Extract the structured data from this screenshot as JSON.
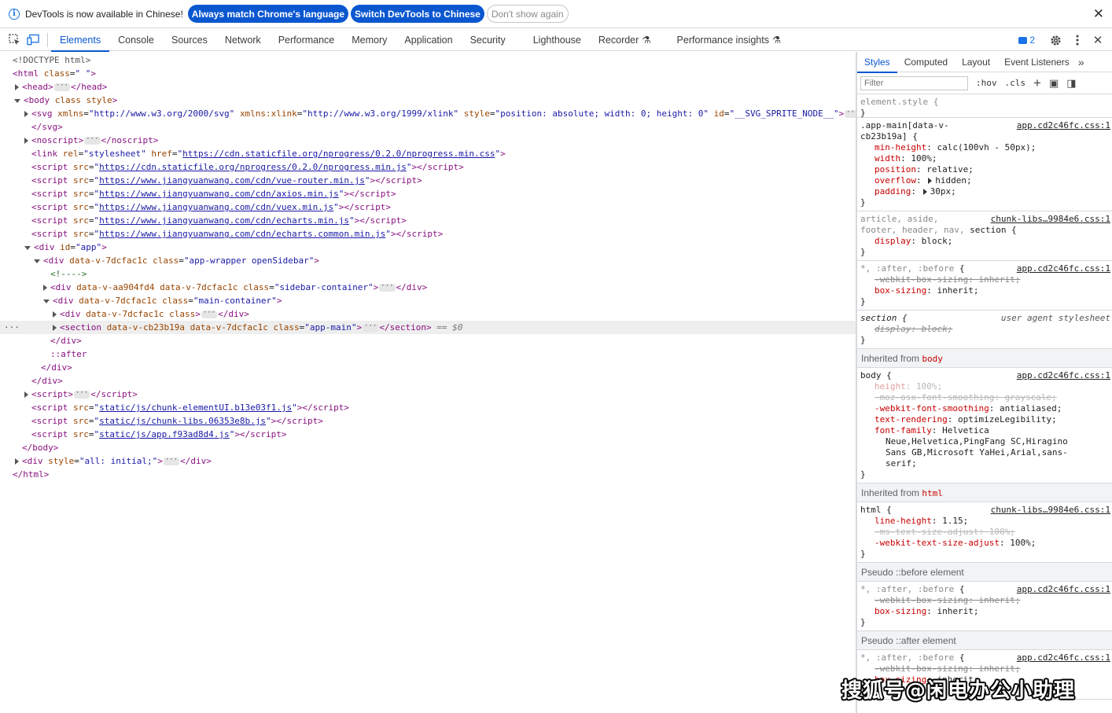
{
  "infobar": {
    "message": "DevTools is now available in Chinese!",
    "btn_match": "Always match Chrome's language",
    "btn_switch": "Switch DevTools to Chinese",
    "btn_dismiss": "Don't show again"
  },
  "toolbar": {
    "tabs": [
      "Elements",
      "Console",
      "Sources",
      "Network",
      "Performance",
      "Memory",
      "Application",
      "Security",
      "Lighthouse",
      "Recorder",
      "Performance insights"
    ],
    "issues_count": "2"
  },
  "dom": {
    "lines": [
      "<!DOCTYPE html>",
      "<html class=\" \">",
      "<head>",
      "</head>",
      "<body class style>",
      "<svg xmlns=\"http://www.w3.org/2000/svg\" xmlns:xlink=\"http://www.w3.org/1999/xlink\" style=\"position: absolute; width: 0; height: 0\" id=\"__SVG_SPRITE_NODE__\">",
      "</svg>",
      "<noscript>",
      "</noscript>"
    ],
    "html_class": "\" \"",
    "svg_xmlns": "\"http://www.w3.org/2000/svg\"",
    "svg_xlink": "\"http://www.w3.org/1999/xlink\"",
    "svg_style": "\"position: absolute; width: 0; height: 0\"",
    "svg_id": "\"__SVG_SPRITE_NODE__\"",
    "nprogress_css": "https://cdn.staticfile.org/nprogress/0.2.0/nprogress.min.css",
    "nprogress_js": "https://cdn.staticfile.org/nprogress/0.2.0/nprogress.min.js",
    "vue_router": "https://www.jiangyuanwang.com/cdn/vue-router.min.js",
    "axios": "https://www.jiangyuanwang.com/cdn/axios.min.js",
    "vuex": "https://www.jiangyuanwang.com/cdn/vuex.min.js",
    "echarts": "https://www.jiangyuanwang.com/cdn/echarts.min.js",
    "echarts_common": "https://www.jiangyuanwang.com/cdn/echarts.common.min.js",
    "app_id": "\"app\"",
    "wrapper_attr": "data-v-7dcfac1c",
    "wrapper_class": "\"app-wrapper openSidebar\"",
    "comment": "<!---->",
    "sidebar_attr": "data-v-aa904fd4 data-v-7dcfac1c",
    "sidebar_class": "\"sidebar-container\"",
    "main_attr": "data-v-7dcfac1c",
    "main_class": "\"main-container\"",
    "inner_attr": "data-v-7dcfac1c",
    "section_attr": "data-v-cb23b19a data-v-7dcfac1c",
    "section_class": "\"app-main\"",
    "selected_marker": "== $0",
    "after": "::after",
    "chunk_element": "static/js/chunk-elementUI.b13e03f1.js",
    "chunk_libs": "static/js/chunk-libs.06353e8b.js",
    "app_js": "static/js/app.f93ad8d4.js",
    "last_div_style": "\"all: initial;\""
  },
  "styles": {
    "tabs": [
      "Styles",
      "Computed",
      "Layout",
      "Event Listeners"
    ],
    "filter_placeholder": "Filter",
    "hov": ":hov",
    "cls": ".cls",
    "element_style": "element.style {",
    "app_main_selector_1": ".app-main[data-v-",
    "app_main_selector_2": "cb23b19a] {",
    "src_app": "app.cd2c46fc.css:1",
    "src_libs": "chunk-libs…9984e6.css:1",
    "app_main_props": [
      {
        "name": "min-height",
        "value": "calc(100vh - 50px);"
      },
      {
        "name": "width",
        "value": "100%;"
      },
      {
        "name": "position",
        "value": "relative;"
      },
      {
        "name": "overflow",
        "value": "hidden;"
      },
      {
        "name": "padding",
        "value": "30px;"
      }
    ],
    "article_selector_1": "article, aside,",
    "article_selector_2": "footer, header, nav,",
    "article_selector_3": "section {",
    "display_block": "block;",
    "star_selector_dim": "*, :after, :before",
    "star_brace": "{",
    "webkit_box_sizing": "-webkit-box-sizing: inherit;",
    "box_sizing_value": "inherit;",
    "section_sel": "section {",
    "ua_label": "user agent stylesheet",
    "ua_display": "display: block;",
    "inherited_from": "Inherited from",
    "inh_body": "body",
    "inh_html": "html",
    "body_sel": "body {",
    "body_height": "100%;",
    "moz_smoothing": "-moz-osx-font-smoothing: grayscale;",
    "webkit_smoothing": "antialiased;",
    "text_rendering": "optimizeLegibility;",
    "font_family_1": "Helvetica",
    "font_family_2": "Neue,Helvetica,PingFang SC,Hiragino",
    "font_family_3": "Sans GB,Microsoft YaHei,Arial,sans-",
    "font_family_4": "serif;",
    "html_sel": "html {",
    "line_height": "1.15;",
    "ms_adjust": "-ms-text-size-adjust: 100%;",
    "webkit_adjust": "100%;",
    "pseudo_before": "Pseudo ::before element",
    "pseudo_after": "Pseudo ::after element"
  },
  "watermark": "搜狐号@闲电办公小助理"
}
